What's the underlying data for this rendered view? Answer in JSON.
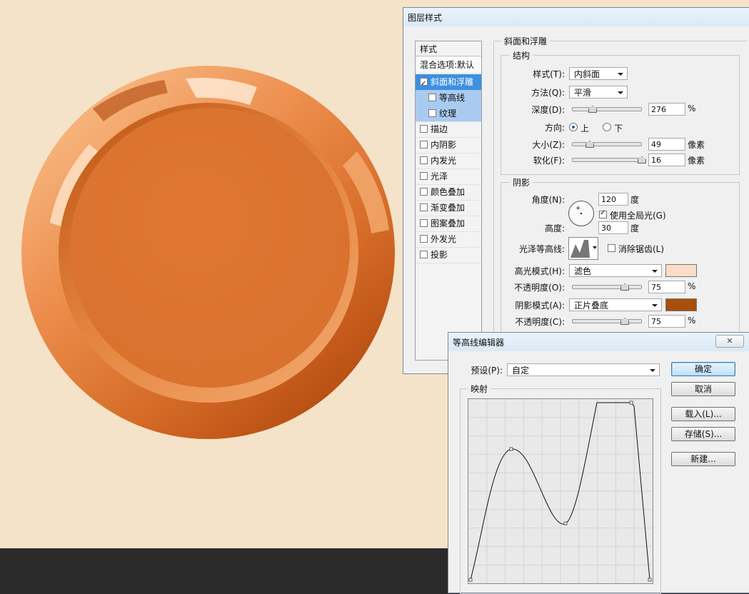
{
  "colors": {
    "canvas": "#f4e3c8",
    "orb": "#de7632",
    "highlight": "#fbdcc7",
    "shadow": "#a84f0c"
  },
  "layer_style": {
    "title": "图层样式",
    "styles_header": "样式",
    "blend_options": "混合选项:默认",
    "items": [
      {
        "label": "斜面和浮雕",
        "checked": true
      },
      {
        "label": "等高线",
        "checked": false
      },
      {
        "label": "纹理",
        "checked": false
      },
      {
        "label": "描边",
        "checked": false
      },
      {
        "label": "内阴影",
        "checked": false
      },
      {
        "label": "内发光",
        "checked": false
      },
      {
        "label": "光泽",
        "checked": false
      },
      {
        "label": "颜色叠加",
        "checked": false
      },
      {
        "label": "渐变叠加",
        "checked": false
      },
      {
        "label": "图案叠加",
        "checked": false
      },
      {
        "label": "外发光",
        "checked": false
      },
      {
        "label": "投影",
        "checked": false
      }
    ],
    "bevel": {
      "section": "斜面和浮雕",
      "structure": "结构",
      "style_label": "样式(T):",
      "style_value": "内斜面",
      "technique_label": "方法(Q):",
      "technique_value": "平滑",
      "depth_label": "深度(D):",
      "depth_value": "276",
      "depth_unit": "%",
      "direction_label": "方向:",
      "dir_up": "上",
      "dir_down": "下",
      "size_label": "大小(Z):",
      "size_value": "49",
      "size_unit": "像素",
      "soften_label": "软化(F):",
      "soften_value": "16",
      "soften_unit": "像素",
      "shading": "阴影",
      "angle_label": "角度(N):",
      "angle_value": "120",
      "angle_unit": "度",
      "global_light": "使用全局光(G)",
      "altitude_label": "高度:",
      "altitude_value": "30",
      "altitude_unit": "度",
      "gloss_label": "光泽等高线:",
      "antialias": "消除锯齿(L)",
      "highlight_label": "高光模式(H):",
      "highlight_value": "滤色",
      "hl_opacity_label": "不透明度(O):",
      "hl_opacity_value": "75",
      "hl_opacity_unit": "%",
      "shadow_label": "阴影模式(A):",
      "shadow_value": "正片叠底",
      "sh_opacity_label": "不透明度(C):",
      "sh_opacity_value": "75",
      "sh_opacity_unit": "%"
    }
  },
  "contour_editor": {
    "title": "等高线编辑器",
    "preset_label": "预设(P):",
    "preset_value": "自定",
    "mapping": "映射",
    "ok": "确定",
    "cancel": "取消",
    "load": "载入(L)...",
    "save": "存储(S)...",
    "new": "新建..."
  }
}
